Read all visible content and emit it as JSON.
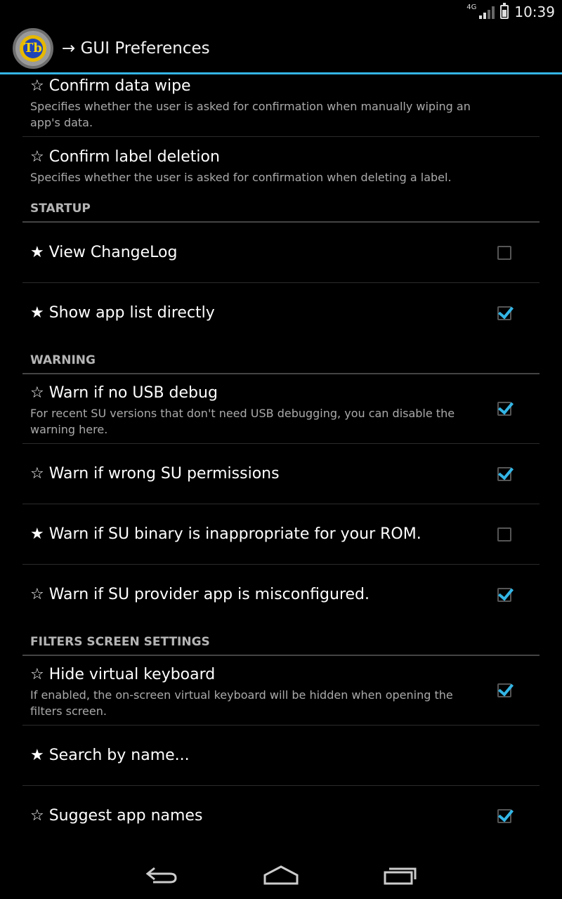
{
  "status_bar": {
    "network": "4G",
    "time": "10:39"
  },
  "action_bar": {
    "title": "→ GUI Preferences",
    "logo_text": "Tb"
  },
  "colors": {
    "accent": "#33b5e5",
    "background": "#000000",
    "summary_text": "#aaaaaa"
  },
  "preferences": {
    "confirm_data_wipe": {
      "title": "☆ Confirm data wipe",
      "summary": "Specifies whether the user is asked for confirmation when manually wiping an app's data."
    },
    "confirm_label_deletion": {
      "title": "☆ Confirm label deletion",
      "summary": "Specifies whether the user is asked for confirmation when deleting a label."
    },
    "startup": {
      "header": "STARTUP",
      "view_changelog": {
        "title": "★ View ChangeLog",
        "checked": false
      },
      "show_app_list": {
        "title": "★ Show app list directly",
        "checked": true
      }
    },
    "warning": {
      "header": "WARNING",
      "usb_debug": {
        "title": "☆ Warn if no USB debug",
        "summary": "For recent SU versions that don't need USB debugging, you can disable the warning here.",
        "checked": true
      },
      "su_permissions": {
        "title": "☆ Warn if wrong SU permissions",
        "checked": true
      },
      "su_binary": {
        "title": "★ Warn if SU binary is inappropriate for your ROM.",
        "checked": false
      },
      "su_provider": {
        "title": "☆ Warn if SU provider app is misconfigured.",
        "checked": true
      }
    },
    "filters": {
      "header": "FILTERS SCREEN SETTINGS",
      "hide_keyboard": {
        "title": "☆ Hide virtual keyboard",
        "summary": "If enabled, the on-screen virtual keyboard will be hidden when opening the filters screen.",
        "checked": true
      },
      "search_by_name": {
        "title": "★ Search by name..."
      },
      "suggest_app_names": {
        "title": "☆ Suggest app names",
        "checked": true
      }
    }
  },
  "nav_bar": {
    "icons": [
      "back-icon",
      "home-icon",
      "recents-icon"
    ]
  }
}
